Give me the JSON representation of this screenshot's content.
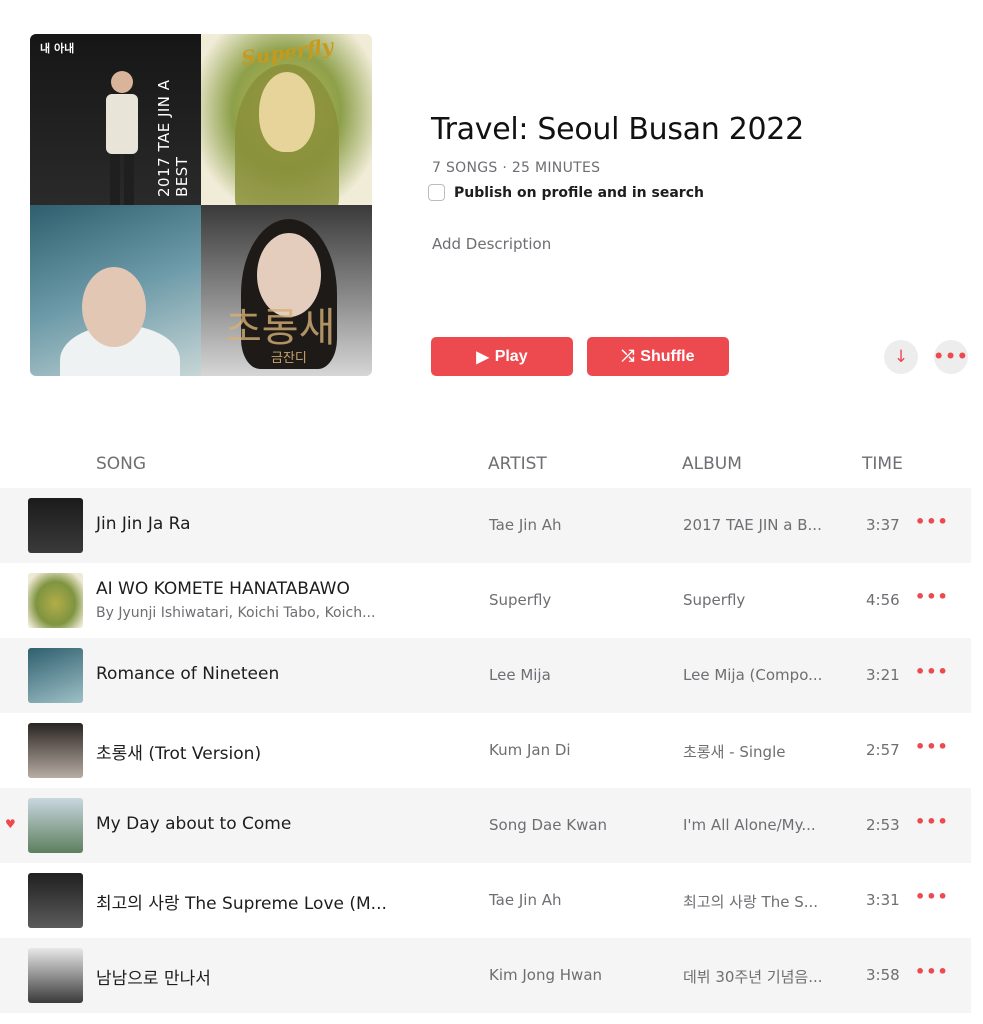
{
  "playlist": {
    "title": "Travel: Seoul Busan 2022",
    "meta": "7 SONGS · 25 MINUTES",
    "publish_label": "Publish on profile and in search",
    "add_description": "Add Description"
  },
  "artwork": {
    "tile1_tag": "내 아내",
    "tile1_vertical": "2017 TAE JIN A BEST",
    "tile2_title": "Superfly",
    "tile4_signature": "초롱새",
    "tile4_sub": "금잔디"
  },
  "actions": {
    "play_label": "Play",
    "shuffle_label": "Shuffle",
    "play_icon": "▶",
    "shuffle_icon": "⤮",
    "download_icon": "↓",
    "more_icon": "•••"
  },
  "columns": {
    "song": "SONG",
    "artist": "ARTIST",
    "album": "ALBUM",
    "time": "TIME"
  },
  "songs": [
    {
      "title": "Jin Jin Ja Ra",
      "subtitle": "",
      "artist": "Tae Jin Ah",
      "album": "2017 TAE JIN a B...",
      "time": "3:37",
      "loved": false
    },
    {
      "title": "AI WO KOMETE HANATABAWO",
      "subtitle": "By Jyunji Ishiwatari, Koichi Tabo, Koich...",
      "artist": "Superfly",
      "album": "Superfly",
      "time": "4:56",
      "loved": false
    },
    {
      "title": "Romance of Nineteen",
      "subtitle": "",
      "artist": "Lee Mija",
      "album": "Lee Mija (Compo...",
      "time": "3:21",
      "loved": false
    },
    {
      "title": "초롱새 (Trot Version)",
      "subtitle": "",
      "artist": "Kum Jan Di",
      "album": "초롱새 - Single",
      "time": "2:57",
      "loved": false
    },
    {
      "title": "My Day about to Come",
      "subtitle": "",
      "artist": "Song Dae Kwan",
      "album": "I'm All Alone/My...",
      "time": "2:53",
      "loved": true
    },
    {
      "title": "최고의 사랑 The Supreme Love (M...",
      "subtitle": "",
      "artist": "Tae Jin Ah",
      "album": "최고의 사랑 The S...",
      "time": "3:31",
      "loved": false
    },
    {
      "title": "남남으로 만나서",
      "subtitle": "",
      "artist": "Kim Jong Hwan",
      "album": "데뷔 30주년 기념음...",
      "time": "3:58",
      "loved": false
    }
  ],
  "icons": {
    "heart": "♥",
    "row_more": "•••"
  },
  "colors": {
    "accent": "#ec4a4f",
    "row_stripe": "#f5f5f5",
    "secondary_text": "#6e6e73"
  }
}
